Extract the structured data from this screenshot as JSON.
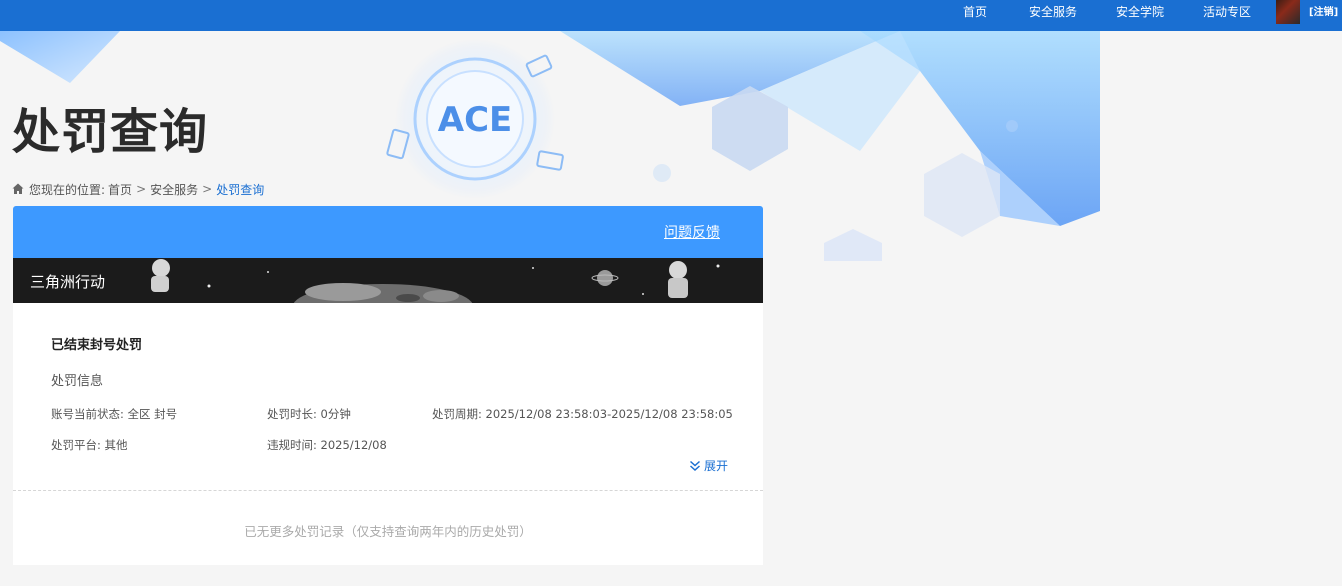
{
  "topnav": {
    "items": [
      "首页",
      "安全服务",
      "安全学院",
      "活动专区"
    ],
    "logout": "[注销]"
  },
  "banner": {
    "logo_text": "ACE"
  },
  "page": {
    "title": "处罚查询"
  },
  "breadcrumb": {
    "prefix": "您现在的位置:",
    "home": "首页",
    "parent": "安全服务",
    "current": "处罚查询",
    "separator": ">"
  },
  "card": {
    "feedback_link": "问题反馈",
    "game_name": "三角洲行动",
    "record": {
      "title": "已结束封号处罚",
      "section_label": "处罚信息",
      "fields": {
        "status": "账号当前状态: 全区 封号",
        "duration": "处罚时长: 0分钟",
        "period": "处罚周期: 2025/12/08 23:58:03-2025/12/08 23:58:05",
        "platform": "处罚平台: 其他",
        "violation_time": "违规时间: 2025/12/08"
      },
      "expand_label": "展开"
    },
    "footer_note": "已无更多处罚记录（仅支持查询两年内的历史处罚）"
  },
  "colors": {
    "topbar": "#1a6fd2",
    "card_header": "#3d99ff",
    "link": "#1a6fd2",
    "page_bg": "#f5f5f5"
  }
}
